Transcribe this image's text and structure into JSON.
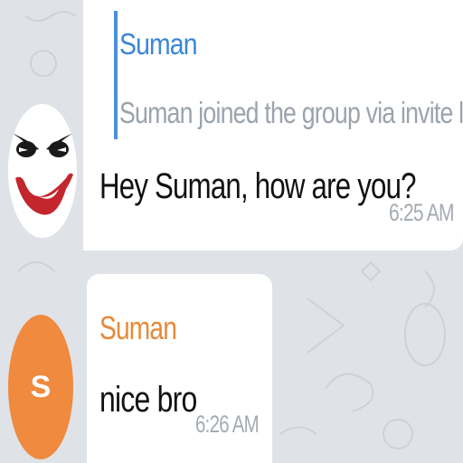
{
  "messages": [
    {
      "reply": {
        "name": "Suman",
        "text": "Suman joined the group via invite li..."
      },
      "text": "Hey Suman, how are you?",
      "time": "6:25 AM",
      "avatar_icon": "joker-face-icon"
    },
    {
      "sender": "Suman",
      "text": "nice bro",
      "time": "6:26 AM",
      "avatar_letter": "S"
    }
  ],
  "colors": {
    "background": "#dfe3e8",
    "reply_accent": "#4a90d9",
    "sender_orange": "#e8893a",
    "avatar_orange": "#ef8a3e"
  }
}
